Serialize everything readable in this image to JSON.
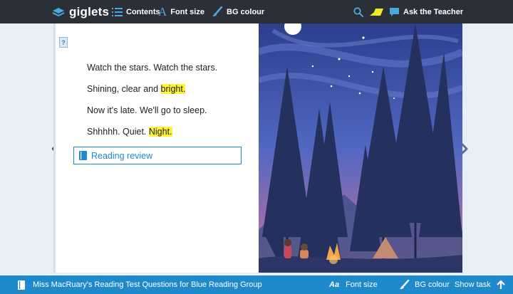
{
  "topbar": {
    "logo": "giglets",
    "contents_label": "Contents",
    "fontsize_label": "Font size",
    "bgcolour_label": "BG colour",
    "ask_label": "Ask the Teacher"
  },
  "page": {
    "lines": [
      {
        "text": "Watch the stars. Watch the stars.",
        "highlight": ""
      },
      {
        "text": "Shining, clear and ",
        "highlight": "bright."
      },
      {
        "text": "Now it's late. We'll go to sleep.",
        "highlight": ""
      },
      {
        "text": "Shhhhh. Quiet. ",
        "highlight": "Night."
      }
    ],
    "review_button": "Reading review"
  },
  "bottombar": {
    "title": "Miss MacRuary's Reading Test Questions for Blue Reading Group",
    "fontsize_label": "Font size",
    "aa_glyph": "Aa",
    "bgcolour_label": "BG colour",
    "showtask_label": "Show task"
  },
  "colors": {
    "topbar": "#2b3036",
    "accent": "#1f8acb",
    "highlight": "#fff23a",
    "page_bg": "#e6eff5"
  }
}
